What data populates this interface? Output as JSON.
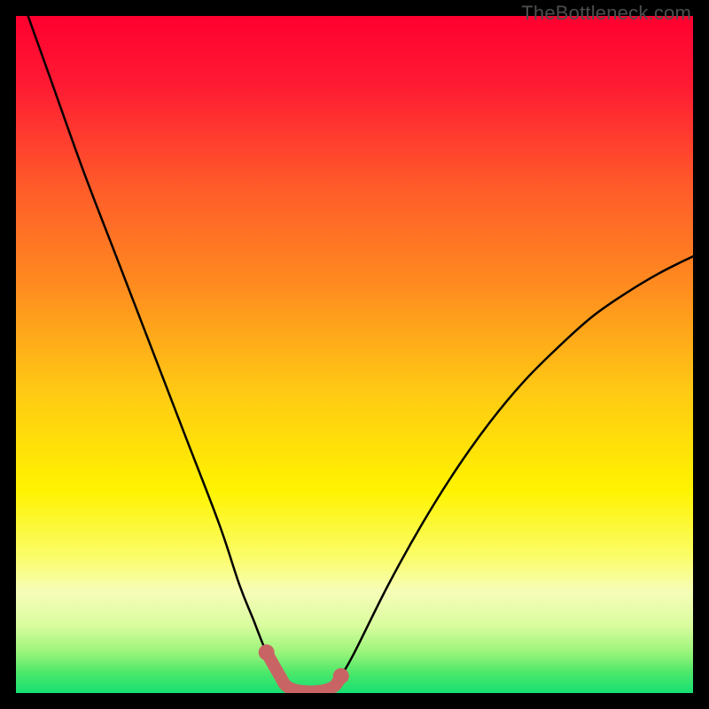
{
  "watermark": "TheBottleneck.com",
  "chart_data": {
    "type": "line",
    "title": "",
    "xlabel": "",
    "ylabel": "",
    "xlim": [
      0,
      100
    ],
    "ylim": [
      0,
      100
    ],
    "grid": false,
    "series": [
      {
        "name": "curve",
        "x": [
          0,
          5,
          10,
          15,
          20,
          25,
          30,
          33,
          35,
          37,
          39,
          40,
          42,
          45,
          47,
          48,
          50,
          55,
          60,
          65,
          70,
          75,
          80,
          85,
          90,
          95,
          100
        ],
        "values": [
          105,
          91,
          77,
          64,
          51,
          38,
          25,
          16,
          11,
          6,
          2.5,
          1,
          0.3,
          0.3,
          1,
          2.5,
          6,
          16,
          25,
          33,
          40,
          46,
          51,
          55.5,
          59,
          62,
          64.5
        ]
      },
      {
        "name": "highlight-band",
        "x": [
          37,
          39,
          40,
          42,
          45,
          47,
          48
        ],
        "values": [
          6,
          2.5,
          1,
          0.3,
          0.3,
          1,
          2.5
        ]
      }
    ],
    "gradient_stops": [
      {
        "offset": 0.0,
        "color": "#ff0030"
      },
      {
        "offset": 0.1,
        "color": "#ff1a33"
      },
      {
        "offset": 0.25,
        "color": "#ff5a2a"
      },
      {
        "offset": 0.4,
        "color": "#ff8c1f"
      },
      {
        "offset": 0.55,
        "color": "#ffc814"
      },
      {
        "offset": 0.7,
        "color": "#fff300"
      },
      {
        "offset": 0.8,
        "color": "#fbfd6a"
      },
      {
        "offset": 0.85,
        "color": "#f6fdb8"
      },
      {
        "offset": 0.9,
        "color": "#dafc9e"
      },
      {
        "offset": 0.94,
        "color": "#99f47a"
      },
      {
        "offset": 0.97,
        "color": "#4be86a"
      },
      {
        "offset": 1.0,
        "color": "#17df72"
      }
    ],
    "highlight_color": "#c96464",
    "curve_color": "#000000"
  }
}
